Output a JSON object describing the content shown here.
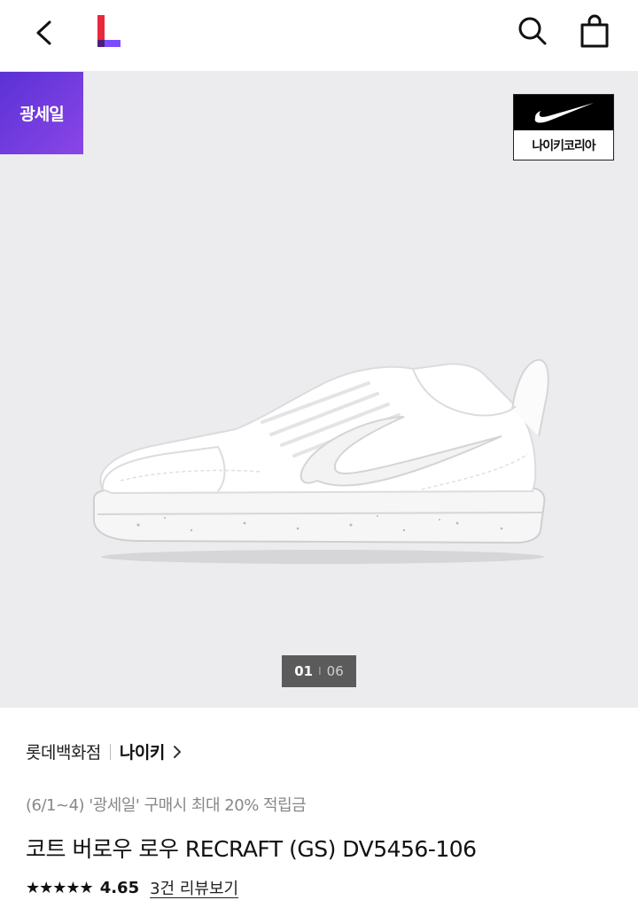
{
  "header": {
    "back_icon": "chevron-left-icon",
    "logo_icon": "lotte-L-logo-icon",
    "search_icon": "search-icon",
    "cart_icon": "shopping-bag-icon"
  },
  "gallery": {
    "sale_badge": "광세일",
    "brand_logo_text": "나이키코리아",
    "current_page": "01",
    "page_separator": "I",
    "total_pages": "06"
  },
  "product": {
    "store": "롯데백화점",
    "brand": "나이키",
    "promo": "(6/1~4) '광세일' 구매시 최대 20% 적립금",
    "title": "코트 버로우 로우 RECRAFT (GS) DV5456-106",
    "stars": "★★★★★",
    "rating": "4.65",
    "reviews_link": "3건 리뷰보기"
  },
  "colors": {
    "sale_badge_start": "#5a31d6",
    "sale_badge_end": "#8b46e6",
    "gallery_bg": "#ececee",
    "logo_red": "#e8283b",
    "logo_purple": "#7c4dff"
  }
}
